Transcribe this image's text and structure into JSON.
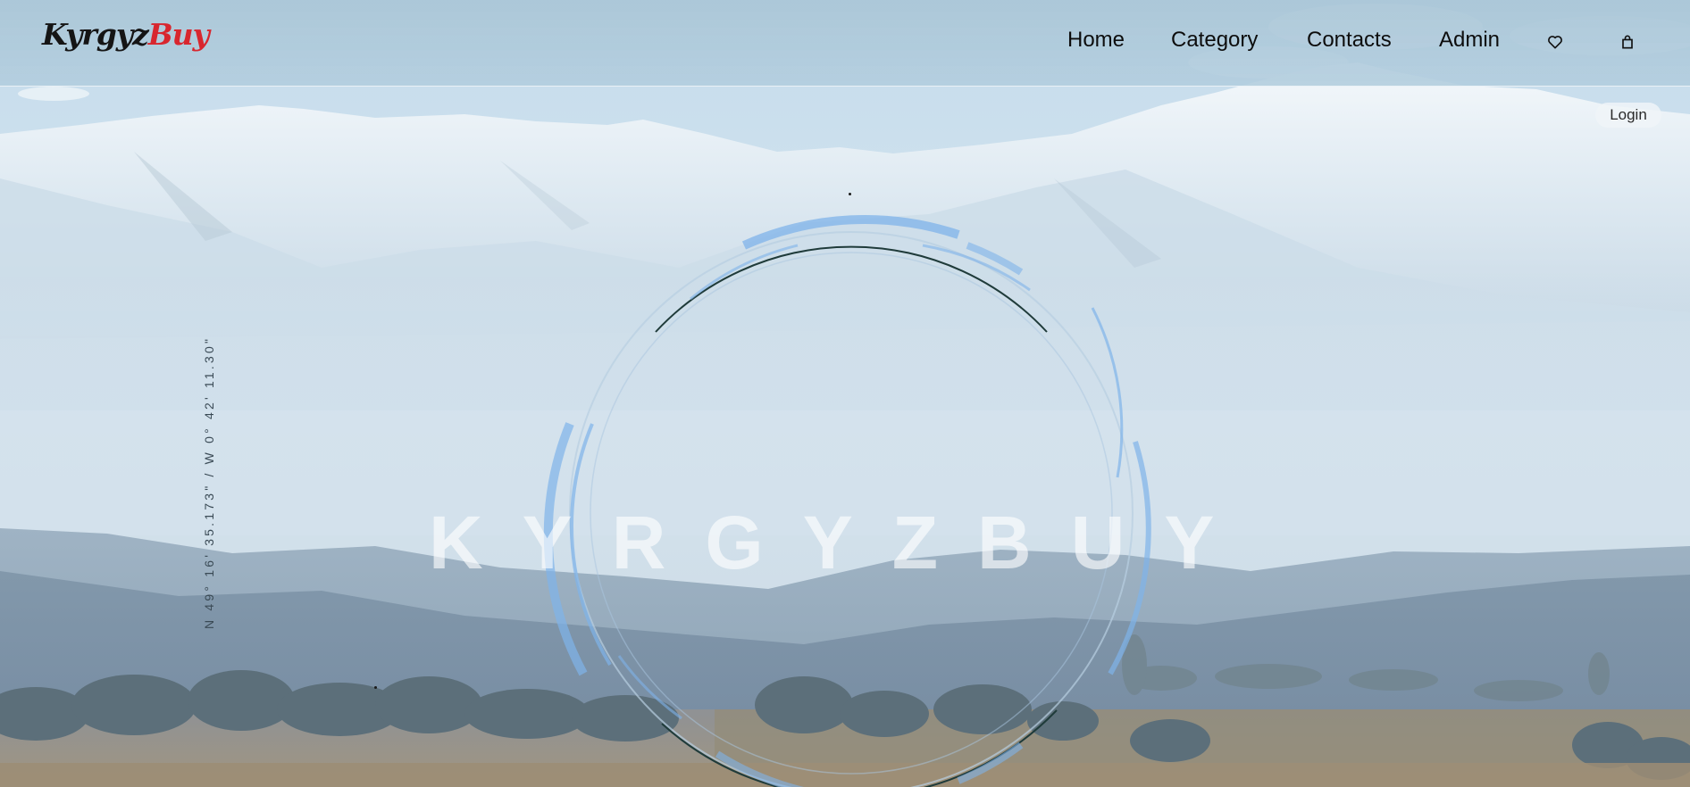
{
  "brand": {
    "logo_part1": "Kyrgyz",
    "logo_part2": "Buy",
    "logo_color": "#d8262e"
  },
  "nav": {
    "items": [
      "Home",
      "Category",
      "Contacts",
      "Admin"
    ],
    "wishlist_icon": "heart-icon",
    "cart_icon": "shopping-bag-icon"
  },
  "auth": {
    "login_label": "Login"
  },
  "hero": {
    "title": "KYRGYZBUY",
    "coordinates": "N 49° 16' 35.173\" / W 0° 42' 11.30\""
  },
  "colors": {
    "ring_dark": "#1f3b3a",
    "ring_blue": "#7fb3ea",
    "header_bg": "#aac6d7"
  }
}
